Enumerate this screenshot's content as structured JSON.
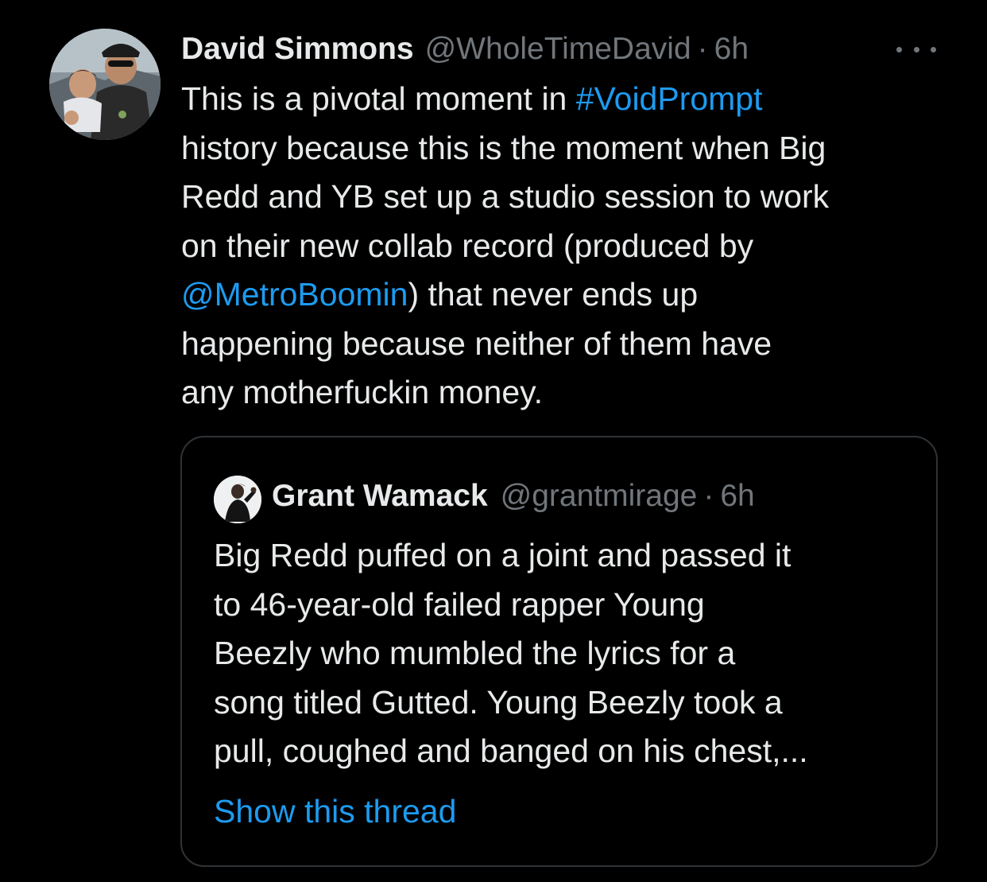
{
  "tweet": {
    "author": {
      "display_name": "David Simmons",
      "handle": "@WholeTimeDavid",
      "separator": "·",
      "time": "6h"
    },
    "body": {
      "line1_pre": "This is a pivotal moment in ",
      "hashtag": "#VoidPrompt",
      "line2": "history because this is the moment when Big",
      "line3": "Redd and YB set up a studio session to work",
      "line4": "on their new collab record (produced by",
      "mention": "@MetroBoomin",
      "line5_post": ") that never ends up",
      "line6": "happening because neither of them have",
      "line7": "any motherfuckin money."
    },
    "more_icon": "more-horizontal-icon"
  },
  "quote": {
    "author": {
      "display_name": "Grant Wamack",
      "handle": "@grantmirage",
      "separator": "·",
      "time": "6h"
    },
    "lines": [
      "Big Redd puffed on a joint and passed it",
      "to 46-year-old failed rapper Young",
      "Beezly who mumbled the lyrics for a",
      "song titled Gutted. Young Beezly took a",
      "pull, coughed and banged on his chest,..."
    ],
    "show_thread": "Show this thread"
  },
  "colors": {
    "background": "#000000",
    "text": "#e7e9ea",
    "muted": "#71767b",
    "link": "#1d9bf0",
    "border": "#2f3336"
  }
}
